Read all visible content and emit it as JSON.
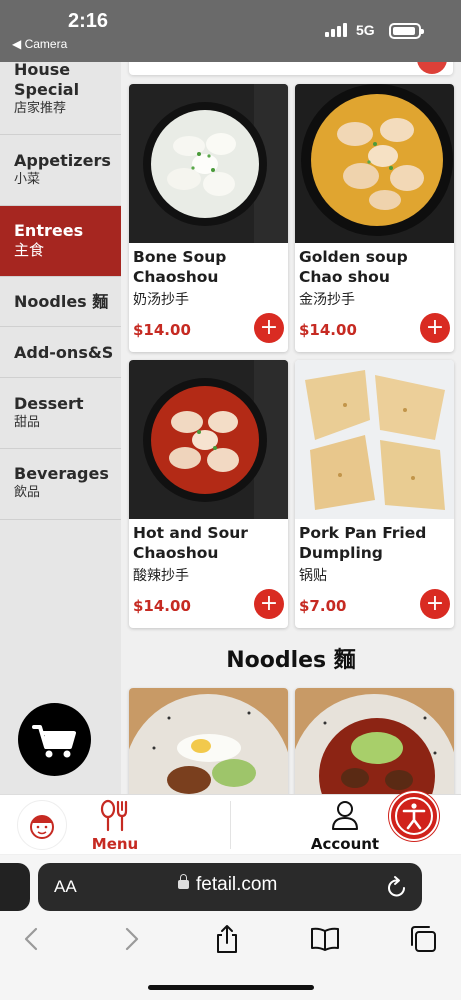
{
  "status_bar": {
    "time": "2:16",
    "back_label": "◀ Camera",
    "network": "5G"
  },
  "sidebar": {
    "categories": [
      {
        "en": "House Special",
        "zh": "店家推荐"
      },
      {
        "en": "Appetizers",
        "zh": "小菜"
      },
      {
        "en": "Entrees",
        "zh": "主食",
        "active": true
      },
      {
        "en": "Noodles 麵",
        "zh": ""
      },
      {
        "en": "Add-ons&S",
        "zh": ""
      },
      {
        "en": "Dessert",
        "zh": "甜品"
      },
      {
        "en": "Beverages",
        "zh": "飲品"
      }
    ]
  },
  "menu": {
    "items": [
      {
        "name": "Bone Soup Chaoshou",
        "zh": "奶汤抄手",
        "price": "$14.00"
      },
      {
        "name": "Golden soup Chao shou",
        "zh": "金汤抄手",
        "price": "$14.00"
      },
      {
        "name": "Hot and Sour Chaoshou",
        "zh": "酸辣抄手",
        "price": "$14.00"
      },
      {
        "name": "Pork Pan Fried Dumpling",
        "zh": "锅贴",
        "price": "$7.00"
      }
    ],
    "add_label": "+",
    "next_section_title": "Noodles 麵"
  },
  "bottom_nav": {
    "menu_label": "Menu",
    "account_label": "Account"
  },
  "browser": {
    "text_size": "AA",
    "url": "fetail.com"
  },
  "colors": {
    "brand_red": "#a62620",
    "accent_red": "#d92b22",
    "price_red": "#c62a22"
  },
  "icons": [
    "cart-icon",
    "menu-utensils-icon",
    "account-icon",
    "accessibility-icon",
    "lock-icon",
    "reload-icon",
    "back-icon",
    "forward-icon",
    "share-icon",
    "bookmarks-icon",
    "tabs-icon"
  ]
}
